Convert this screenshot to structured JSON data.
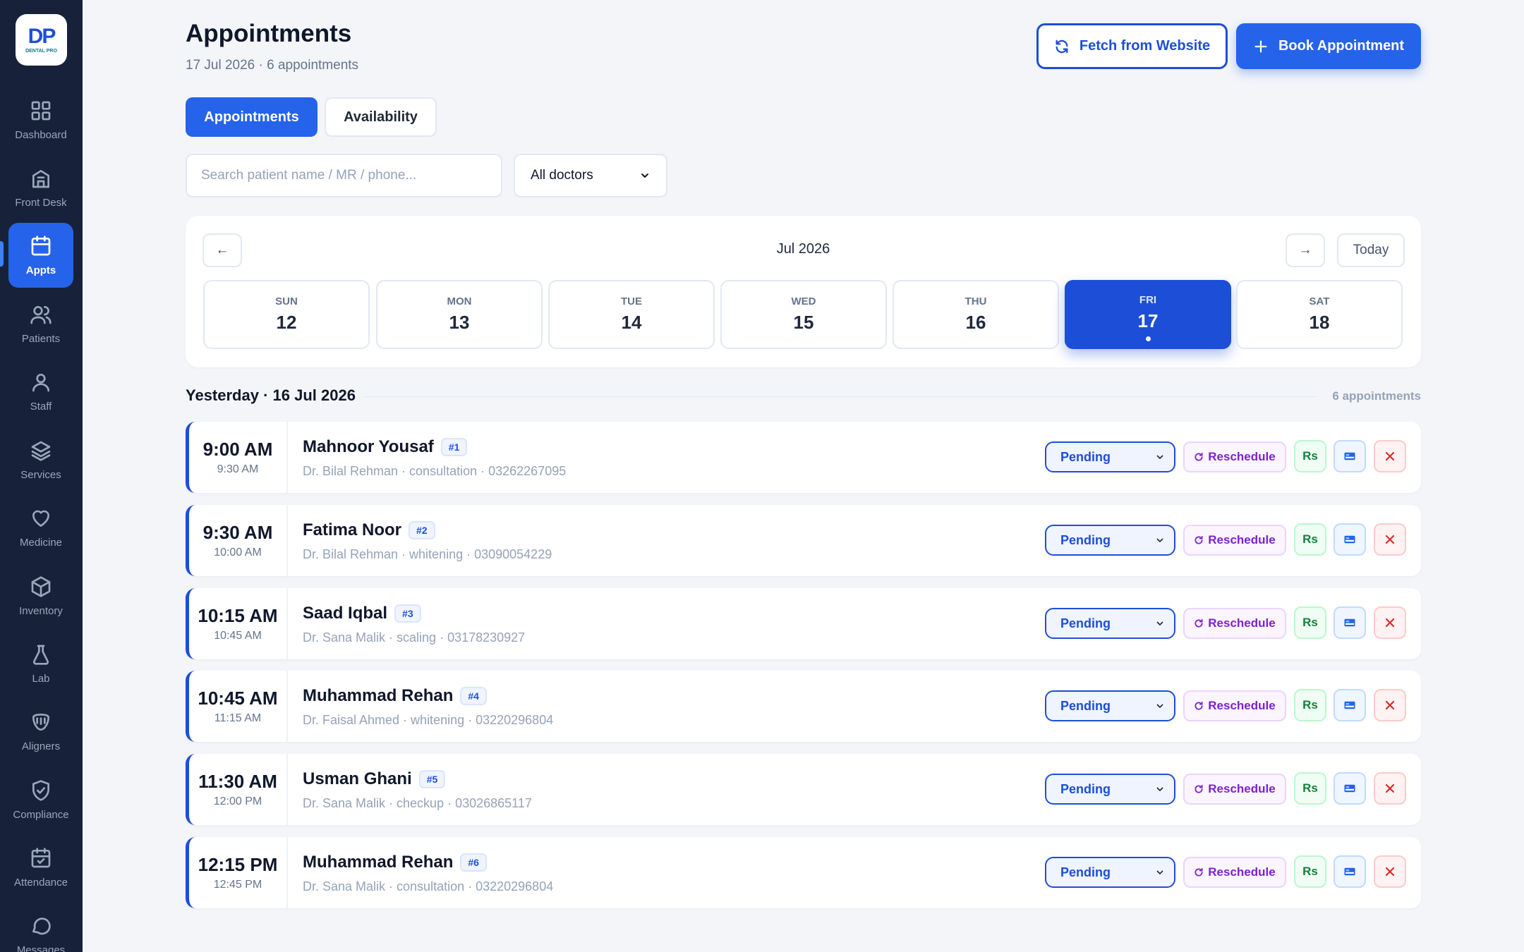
{
  "app": {
    "logo_text": "DP",
    "logo_caption": "DENTAL PRO"
  },
  "sidebar": {
    "items": [
      {
        "label": "Dashboard",
        "icon": "grid-icon"
      },
      {
        "label": "Front Desk",
        "icon": "building-icon"
      },
      {
        "label": "Appts",
        "icon": "calendar-icon",
        "active": true
      },
      {
        "label": "Patients",
        "icon": "users-icon"
      },
      {
        "label": "Staff",
        "icon": "user-icon"
      },
      {
        "label": "Services",
        "icon": "layers-icon"
      },
      {
        "label": "Medicine",
        "icon": "heart-icon"
      },
      {
        "label": "Inventory",
        "icon": "box-icon"
      },
      {
        "label": "Lab",
        "icon": "flask-icon"
      },
      {
        "label": "Aligners",
        "icon": "aligner-icon"
      },
      {
        "label": "Compliance",
        "icon": "shield-check-icon"
      },
      {
        "label": "Attendance",
        "icon": "calendar-check-icon"
      },
      {
        "label": "Messages",
        "icon": "message-icon"
      }
    ]
  },
  "header": {
    "title": "Appointments",
    "subtitle": "17 Jul 2026 · 6 appointments",
    "fetch_label": "Fetch from Website",
    "book_label": "Book Appointment"
  },
  "tabs": {
    "appointments": "Appointments",
    "availability": "Availability"
  },
  "filters": {
    "search_placeholder": "Search patient name / MR / phone...",
    "doctor_value": "All doctors"
  },
  "calendar": {
    "month": "Jul 2026",
    "prev": "←",
    "next": "→",
    "today": "Today",
    "days": [
      {
        "name": "SUN",
        "date": "12"
      },
      {
        "name": "MON",
        "date": "13"
      },
      {
        "name": "TUE",
        "date": "14"
      },
      {
        "name": "WED",
        "date": "15"
      },
      {
        "name": "THU",
        "date": "16"
      },
      {
        "name": "FRI",
        "date": "17",
        "selected": true
      },
      {
        "name": "SAT",
        "date": "18"
      }
    ]
  },
  "group": {
    "title": "Yesterday · 16 Jul 2026",
    "count": "6 appointments"
  },
  "actions": {
    "status": "Pending",
    "reschedule": "Reschedule",
    "rs": "Rs"
  },
  "appointments": [
    {
      "start": "9:00 AM",
      "end": "9:30 AM",
      "name": "Mahnoor Yousaf",
      "token": "#1",
      "meta": "Dr. Bilal Rehman · consultation · 03262267095"
    },
    {
      "start": "9:30 AM",
      "end": "10:00 AM",
      "name": "Fatima Noor",
      "token": "#2",
      "meta": "Dr. Bilal Rehman · whitening · 03090054229"
    },
    {
      "start": "10:15 AM",
      "end": "10:45 AM",
      "name": "Saad Iqbal",
      "token": "#3",
      "meta": "Dr. Sana Malik · scaling · 03178230927"
    },
    {
      "start": "10:45 AM",
      "end": "11:15 AM",
      "name": "Muhammad Rehan",
      "token": "#4",
      "meta": "Dr. Faisal Ahmed · whitening · 03220296804"
    },
    {
      "start": "11:30 AM",
      "end": "12:00 PM",
      "name": "Usman Ghani",
      "token": "#5",
      "meta": "Dr. Sana Malik · checkup · 03026865117"
    },
    {
      "start": "12:15 PM",
      "end": "12:45 PM",
      "name": "Muhammad Rehan",
      "token": "#6",
      "meta": "Dr. Sana Malik · consultation · 03220296804"
    }
  ],
  "colors": {
    "primary": "#2563eb",
    "sidebar_bg": "#17223a",
    "page_bg": "#f3f5f9"
  }
}
